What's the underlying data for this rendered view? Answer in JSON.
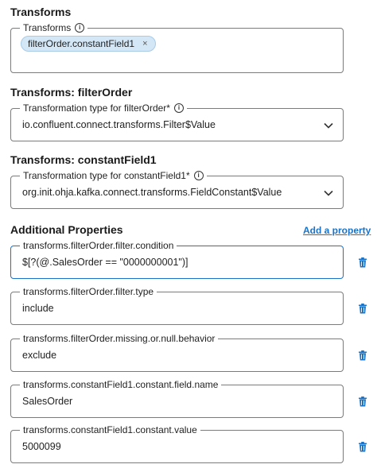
{
  "transforms_section": {
    "title": "Transforms",
    "field_label": "Transforms",
    "chips": [
      {
        "label": "filterOrder.constantField1",
        "remove": "×"
      }
    ]
  },
  "filter_order_section": {
    "title": "Transforms: filterOrder",
    "field_label": "Transformation type for filterOrder*",
    "value": "io.confluent.connect.transforms.Filter$Value"
  },
  "constant_field_section": {
    "title": "Transforms: constantField1",
    "field_label": "Transformation type for constantField1*",
    "value": "org.init.ohja.kafka.connect.transforms.FieldConstant$Value"
  },
  "additional_properties": {
    "title": "Additional Properties",
    "add_link": "Add a property",
    "properties": [
      {
        "label": "transforms.filterOrder.filter.condition",
        "value": "$[?(@.SalesOrder == \"0000000001\")]"
      },
      {
        "label": "transforms.filterOrder.filter.type",
        "value": "include"
      },
      {
        "label": "transforms.filterOrder.missing.or.null.behavior",
        "value": "exclude"
      },
      {
        "label": "transforms.constantField1.constant.field.name",
        "value": "SalesOrder"
      },
      {
        "label": "transforms.constantField1.constant.value",
        "value": "5000099"
      }
    ]
  },
  "icons": {
    "info": "info-icon",
    "chevron": "chevron-down-icon",
    "delete": "trash-icon"
  },
  "colors": {
    "accent": "#1a73c7",
    "chip_background": "#d4e7f6",
    "border": "#7b7b7b"
  }
}
